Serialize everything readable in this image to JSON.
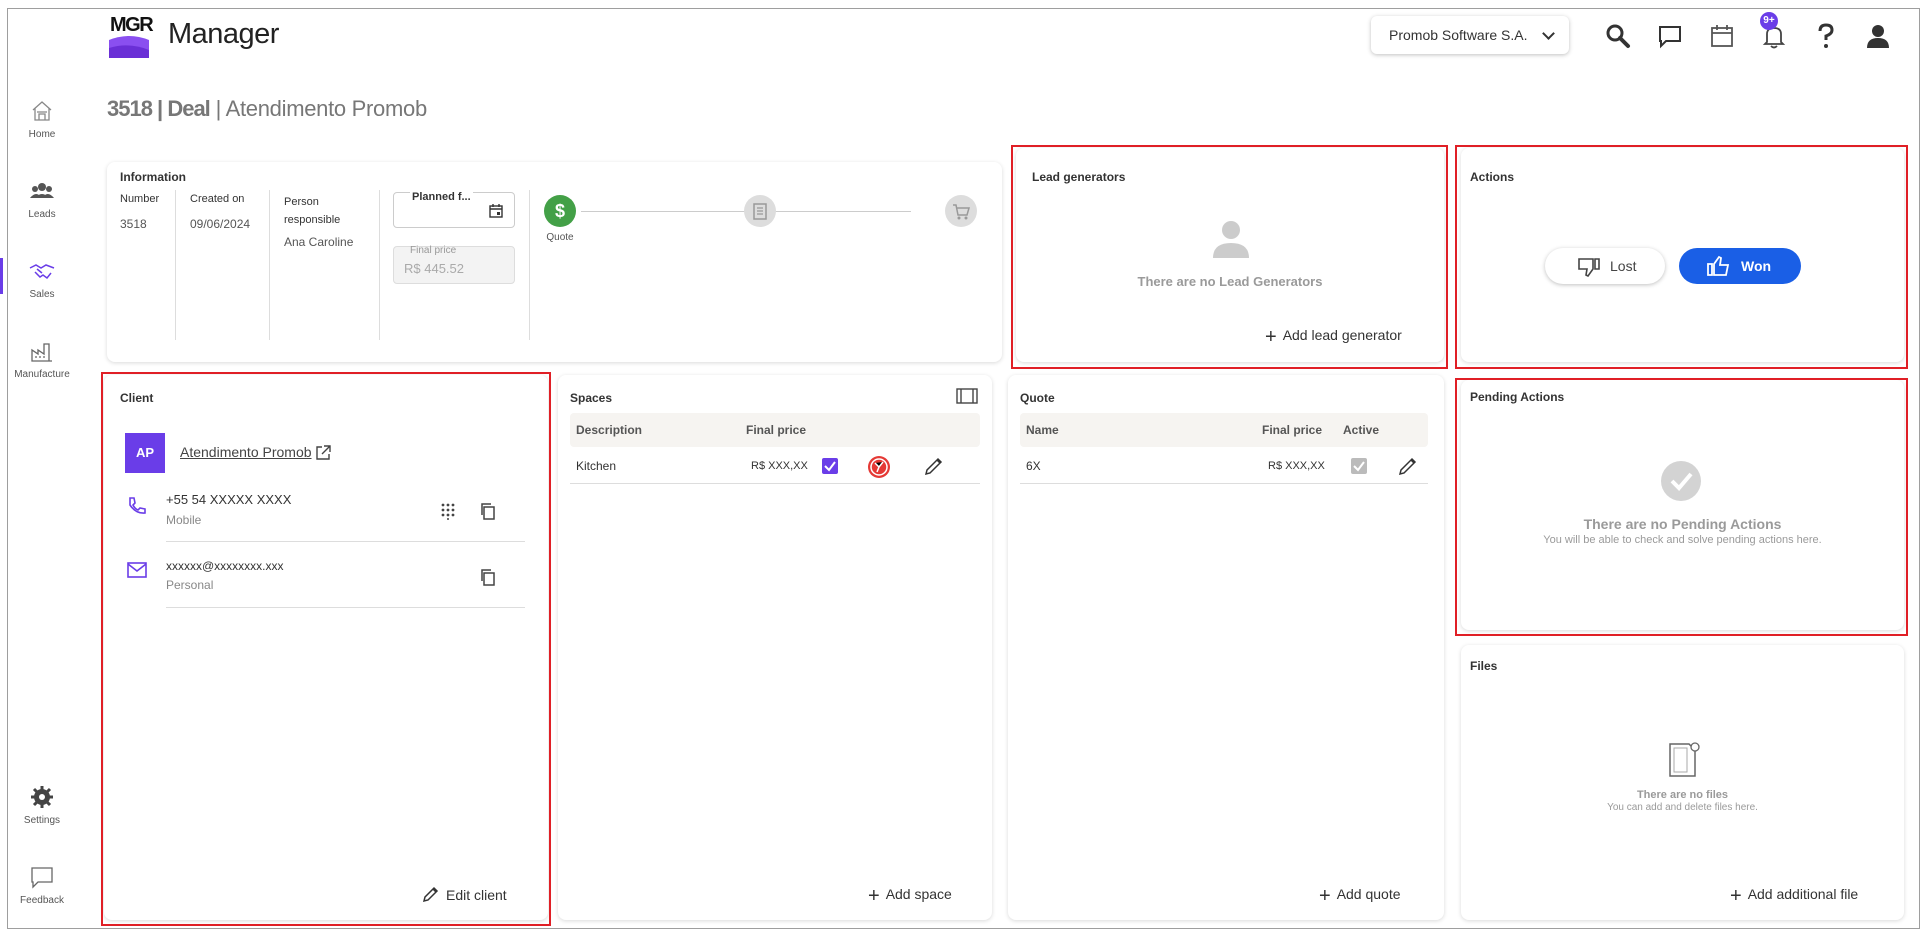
{
  "app": {
    "logo_text": "MGR",
    "title": "Manager"
  },
  "header": {
    "org_name": "Promob Software S.A.",
    "notification_count": "9+"
  },
  "nav": [
    {
      "label": "Home"
    },
    {
      "label": "Leads"
    },
    {
      "label": "Sales",
      "active": true
    },
    {
      "label": "Manufacture"
    },
    {
      "label": "Settings"
    },
    {
      "label": "Feedback"
    }
  ],
  "page": {
    "deal_id": "3518 | Deal",
    "deal_name": "| Atendimento Promob"
  },
  "information": {
    "title": "Information",
    "number_label": "Number",
    "number_value": "3518",
    "created_label": "Created on",
    "created_value": "09/06/2024",
    "person_label": "Person responsible",
    "person_value": "Ana Caroline",
    "planned_label": "Planned f...",
    "final_price_label": "Final price",
    "final_price_value": "R$ 445.52",
    "steps": [
      {
        "label": "Quote",
        "done": true
      },
      {
        "label": ""
      },
      {
        "label": ""
      }
    ]
  },
  "lead_generators": {
    "title": "Lead generators",
    "empty_text": "There are no Lead Generators",
    "add_label": "Add lead generator"
  },
  "actions": {
    "title": "Actions",
    "lost_label": "Lost",
    "won_label": "Won"
  },
  "client": {
    "title": "Client",
    "initials": "AP",
    "name": "Atendimento Promob",
    "phone": "+55 54 XXXXX XXXX",
    "phone_type": "Mobile",
    "email": "xxxxxx@xxxxxxxx.xxx",
    "email_type": "Personal",
    "edit_label": "Edit client"
  },
  "spaces": {
    "title": "Spaces",
    "columns": [
      "Description",
      "Final price"
    ],
    "rows": [
      {
        "description": "Kitchen",
        "price": "R$ XXX,XX",
        "checked": true
      }
    ],
    "add_label": "Add space"
  },
  "quote": {
    "title": "Quote",
    "columns": [
      "Name",
      "Final price",
      "Active"
    ],
    "rows": [
      {
        "name": "6X",
        "price": "R$ XXX,XX",
        "active": true
      }
    ],
    "add_label": "Add quote"
  },
  "pending_actions": {
    "title": "Pending Actions",
    "empty_title": "There are no Pending Actions",
    "empty_sub": "You will be able to check and solve pending actions here."
  },
  "files": {
    "title": "Files",
    "empty_title": "There are no files",
    "empty_sub": "You can add and delete files here.",
    "add_label": "Add additional file"
  },
  "colors": {
    "accent": "#6a3de8",
    "primary_button": "#1a5fe6",
    "highlight_border": "#e01f26",
    "success": "#43a047"
  }
}
